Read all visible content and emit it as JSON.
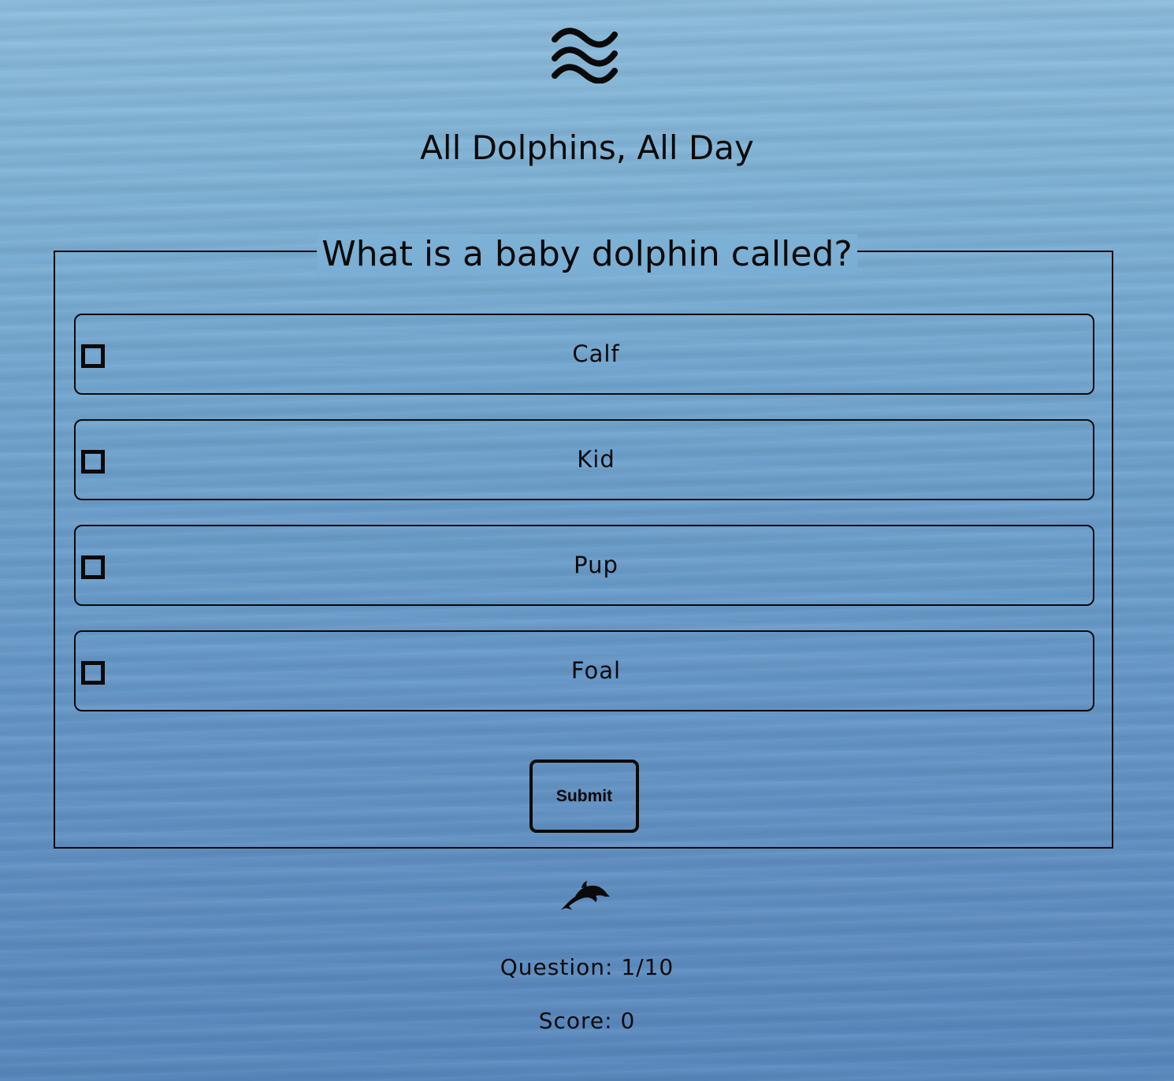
{
  "header": {
    "logo_icon": "waves-icon",
    "title": "All Dolphins, All Day"
  },
  "quiz": {
    "question": "What is a baby dolphin called?",
    "answers": [
      {
        "label": "Calf",
        "checked": false
      },
      {
        "label": "Kid",
        "checked": false
      },
      {
        "label": "Pup",
        "checked": false
      },
      {
        "label": "Foal",
        "checked": false
      }
    ],
    "submit_label": "Submit"
  },
  "footer": {
    "icon": "dolphin-icon",
    "question_progress": "Question: 1/10",
    "score": "Score: 0"
  },
  "colors": {
    "text": "#0a0a0a",
    "water_top": "#8cbcdc",
    "water_bottom": "#5888be"
  }
}
